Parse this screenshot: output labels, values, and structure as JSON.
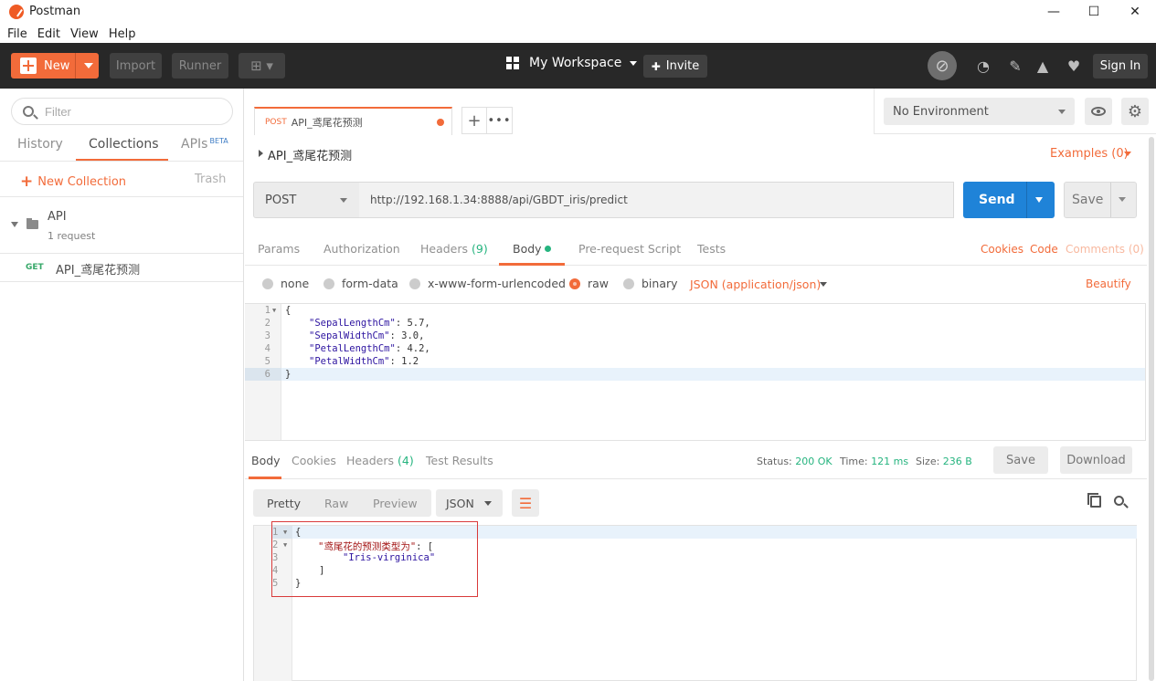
{
  "window": {
    "title": "Postman",
    "minimize": "—",
    "maximize": "☐",
    "close": "✕"
  },
  "menu": [
    "File",
    "Edit",
    "View",
    "Help"
  ],
  "header": {
    "new_label": "New",
    "import_label": "Import",
    "runner_label": "Runner",
    "workspace": "My Workspace",
    "invite_label": "Invite",
    "signin_label": "Sign In"
  },
  "sidebar": {
    "filter_placeholder": "Filter",
    "tabs": [
      "History",
      "Collections",
      "APIs"
    ],
    "beta_label": "BETA",
    "new_collection": "New Collection",
    "trash": "Trash",
    "collection": {
      "name": "API",
      "count": "1 request"
    },
    "request": {
      "method": "GET",
      "name": "API_鸢尾花预测"
    }
  },
  "tab": {
    "method": "POST",
    "title": "API_鸢尾花预测"
  },
  "environment": {
    "selected": "No Environment"
  },
  "request": {
    "title": "API_鸢尾花预测",
    "examples": "Examples (0)",
    "method": "POST",
    "url": "http://192.168.1.34:8888/api/GBDT_iris/predict",
    "send_label": "Send",
    "save_label": "Save",
    "tabs": {
      "params": "Params",
      "authorization": "Authorization",
      "headers": "Headers",
      "headers_count": "(9)",
      "body": "Body",
      "prerequest": "Pre-request Script",
      "tests": "Tests"
    },
    "links": {
      "cookies": "Cookies",
      "code": "Code",
      "comments": "Comments (0)"
    },
    "body_types": {
      "none": "none",
      "form_data": "form-data",
      "urlencoded": "x-www-form-urlencoded",
      "raw": "raw",
      "binary": "binary",
      "json_type": "JSON (application/json)",
      "beautify": "Beautify"
    },
    "body_lines": [
      {
        "n": "1",
        "text": "{"
      },
      {
        "n": "2",
        "key": "\"SepalLengthCm\"",
        "val": ": 5.7,"
      },
      {
        "n": "3",
        "key": "\"SepalWidthCm\"",
        "val": ": 3.0,"
      },
      {
        "n": "4",
        "key": "\"PetalLengthCm\"",
        "val": ": 4.2,"
      },
      {
        "n": "5",
        "key": "\"PetalWidthCm\"",
        "val": ": 1.2"
      },
      {
        "n": "6",
        "text": "}"
      }
    ]
  },
  "response": {
    "tabs": {
      "body": "Body",
      "cookies": "Cookies",
      "headers": "Headers",
      "headers_count": "(4)",
      "test_results": "Test Results"
    },
    "status_label": "Status:",
    "status_value": "200 OK",
    "time_label": "Time:",
    "time_value": "121 ms",
    "size_label": "Size:",
    "size_value": "236 B",
    "save_label": "Save",
    "download_label": "Download",
    "views": [
      "Pretty",
      "Raw",
      "Preview"
    ],
    "format": "JSON",
    "lines": [
      {
        "n": "1",
        "text": "{"
      },
      {
        "n": "2",
        "key": "\"鸢尾花的预测类型为\"",
        "rest": ": ["
      },
      {
        "n": "3",
        "val": "\"Iris-virginica\""
      },
      {
        "n": "4",
        "text": "]"
      },
      {
        "n": "5",
        "text": "}"
      }
    ]
  },
  "colors": {
    "accent": "#f26b3a",
    "send": "#1f83d8",
    "header_bg": "#282828",
    "success": "#26b47f"
  }
}
